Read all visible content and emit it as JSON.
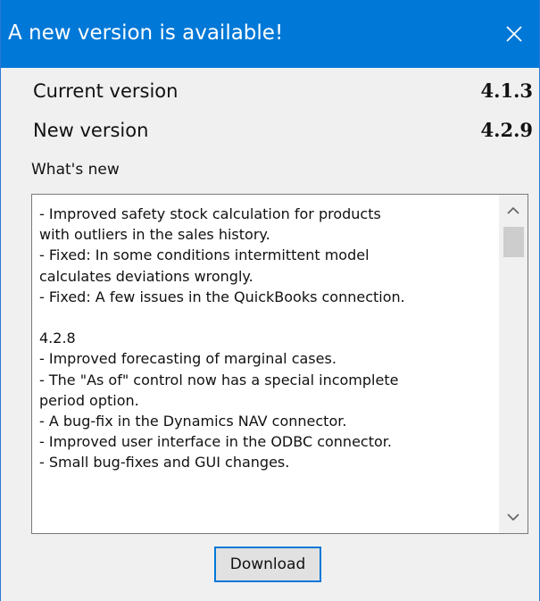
{
  "window": {
    "title": "A new version is available!",
    "close_icon": "close-icon"
  },
  "versions": {
    "current_label": "Current version",
    "current_value": "4.1.3",
    "new_label": "New version",
    "new_value": "4.2.9"
  },
  "whats_new": {
    "label": "What's new",
    "notes": "- Improved safety stock calculation for products\nwith outliers in the sales history.\n- Fixed: In some conditions intermittent model\ncalculates deviations wrongly.\n- Fixed: A few issues in the QuickBooks connection.\n\n4.2.8\n- Improved forecasting of marginal cases.\n- The \"As of\" control now has a special incomplete\nperiod option.\n- A bug-fix in the Dynamics NAV connector.\n- Improved user interface in the ODBC connector.\n- Small bug-fixes and GUI changes."
  },
  "actions": {
    "download_label": "Download"
  },
  "colors": {
    "titlebar": "#0078d7",
    "button_border": "#0078d7"
  }
}
